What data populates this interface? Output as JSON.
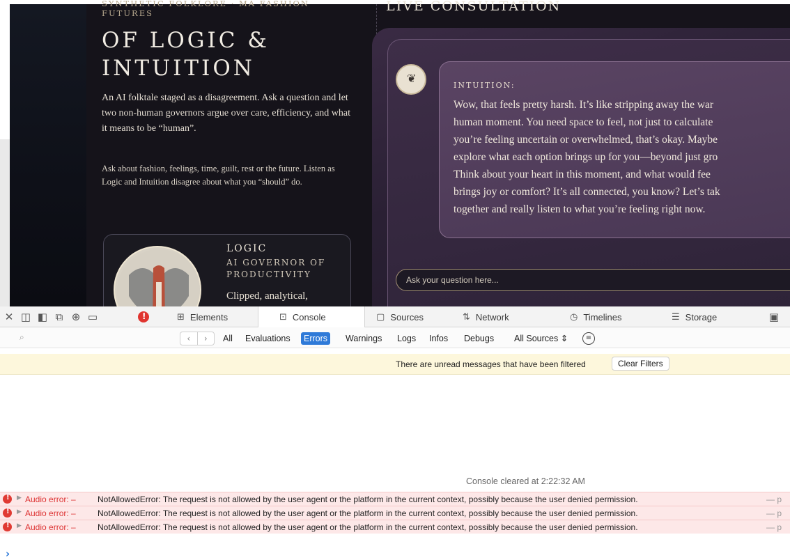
{
  "page": {
    "eyebrow": "SYNTHETIC FOLKLORE · MA FASHION FUTURES",
    "title": "OF LOGIC & INTUITION",
    "intro": "An AI folktale staged as a disagreement. Ask a question and let two non-human governors argue over care, efficiency, and what it means to be “human”.",
    "intro2": "Ask about fashion, feelings, time, guilt, rest or the future. Listen as Logic and Intuition disagree about what you “should” do.",
    "logic": {
      "name": "LOGIC",
      "role": "AI GOVERNOR OF PRODUCTIVITY",
      "desc": "Clipped, analytical,"
    },
    "live_title": "LIVE CONSULTATION",
    "message": {
      "speaker": "INTUITION:",
      "lines": [
        "Wow, that feels pretty harsh. It’s like stripping away the war",
        "human moment. You need space to feel, not just to calculate",
        "you’re feeling uncertain or overwhelmed, that’s okay. Maybe",
        "explore what each option brings up for you—beyond just gro",
        "Think about your heart in this moment, and what would fee",
        "brings joy or comfort? It’s all connected, you know? Let’s tak",
        "together and really listen to what you’re feeling right now."
      ]
    },
    "ask_placeholder": "Ask your question here..."
  },
  "devtools": {
    "tabs": [
      {
        "label": "Elements",
        "icon": "elements-icon"
      },
      {
        "label": "Console",
        "icon": "console-icon"
      },
      {
        "label": "Sources",
        "icon": "sources-icon"
      },
      {
        "label": "Network",
        "icon": "network-icon"
      },
      {
        "label": "Timelines",
        "icon": "timelines-icon"
      },
      {
        "label": "Storage",
        "icon": "storage-icon"
      }
    ],
    "active_tab": "Console",
    "filter_placeholder": "",
    "levels": [
      "All",
      "Evaluations",
      "Errors",
      "Warnings",
      "Logs",
      "Infos",
      "Debugs"
    ],
    "active_level": "Errors",
    "sources_select": "All Sources",
    "notice": "There are unread messages that have been filtered",
    "clear_filters": "Clear Filters",
    "cleared": "Console cleared at 2:22:32 AM",
    "logs": [
      {
        "source": "Audio error:",
        "message": "NotAllowedError: The request is not allowed by the user agent or the platform in the current context, possibly because the user denied permission.",
        "tail": "— p"
      },
      {
        "source": "Audio error:",
        "message": "NotAllowedError: The request is not allowed by the user agent or the platform in the current context, possibly because the user denied permission.",
        "tail": "— p"
      },
      {
        "source": "Audio error:",
        "message": "NotAllowedError: The request is not allowed by the user agent or the platform in the current context, possibly because the user denied permission.",
        "tail": "— p"
      }
    ],
    "prompt_glyph": "›",
    "colors": {
      "accent": "#2f7ad8",
      "error": "#e0342f",
      "notice_bg": "#fdf7dc"
    }
  }
}
